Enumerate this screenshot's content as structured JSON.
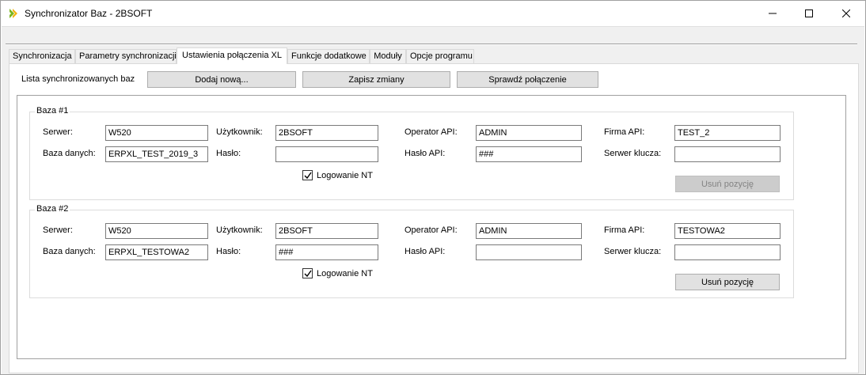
{
  "window": {
    "title": "Synchronizator Baz - 2BSOFT"
  },
  "tabs": [
    "Synchronizacja",
    "Parametry synchronizacji",
    "Ustawienia połączenia XL",
    "Funkcje dodatkowe",
    "Moduły",
    "Opcje programu"
  ],
  "toolbar": {
    "list_label": "Lista synchronizowanych baz",
    "add_label": "Dodaj nową...",
    "save_label": "Zapisz zmiany",
    "check_label": "Sprawdź połączenie"
  },
  "labels": {
    "server": "Serwer:",
    "database": "Baza danych:",
    "user": "Użytkownik:",
    "password": "Hasło:",
    "api_operator": "Operator API:",
    "api_password": "Hasło API:",
    "api_company": "Firma API:",
    "key_server": "Serwer klucza:",
    "nt_login": "Logowanie NT",
    "remove": "Usuń pozycję"
  },
  "databases": [
    {
      "title": "Baza #1",
      "server": "W520",
      "database": "ERPXL_TEST_2019_3",
      "user": "2BSOFT",
      "password": "",
      "api_operator": "ADMIN",
      "api_password": "###",
      "api_company": "TEST_2",
      "key_server": "",
      "nt_login": true,
      "remove_enabled": false
    },
    {
      "title": "Baza #2",
      "server": "W520",
      "database": "ERPXL_TESTOWA2",
      "user": "2BSOFT",
      "password": "###",
      "api_operator": "ADMIN",
      "api_password": "",
      "api_company": "TESTOWA2",
      "key_server": "",
      "nt_login": true,
      "remove_enabled": true
    }
  ],
  "colors": {
    "icon_green": "#7ab51d",
    "icon_yellow": "#f2b10c"
  }
}
